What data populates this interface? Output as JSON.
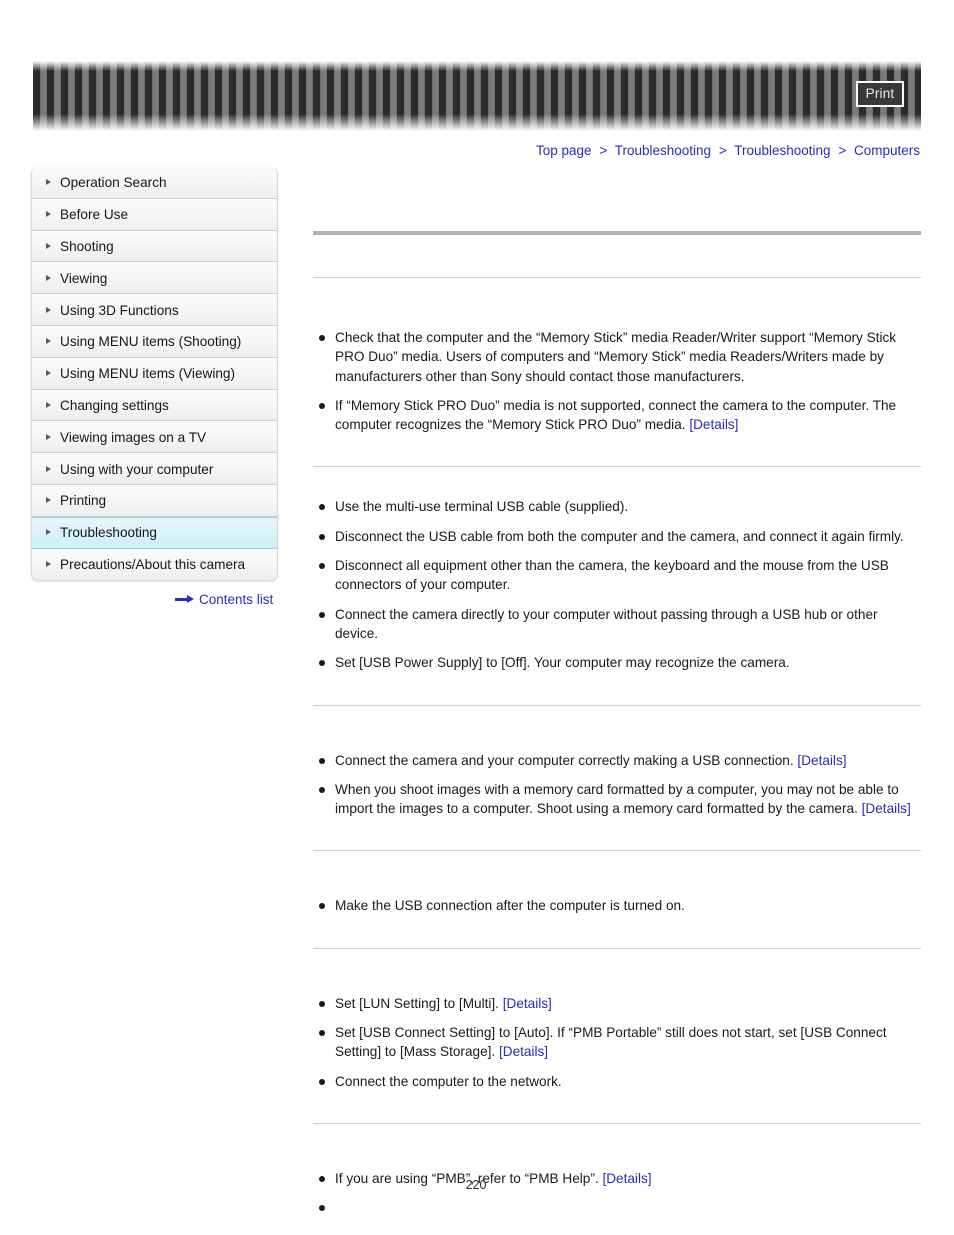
{
  "toolbar": {
    "print_label": "Print",
    "print_icon": "print-icon"
  },
  "breadcrumb": {
    "items": [
      {
        "label": "Top page"
      },
      {
        "label": "Troubleshooting"
      },
      {
        "label": "Troubleshooting"
      },
      {
        "label": "Computers"
      }
    ],
    "separator": ">"
  },
  "sidebar": {
    "items": [
      {
        "label": "Operation Search",
        "selected": false
      },
      {
        "label": "Before Use",
        "selected": false
      },
      {
        "label": "Shooting",
        "selected": false
      },
      {
        "label": "Viewing",
        "selected": false
      },
      {
        "label": "Using 3D Functions",
        "selected": false
      },
      {
        "label": "Using MENU items (Shooting)",
        "selected": false
      },
      {
        "label": "Using MENU items (Viewing)",
        "selected": false
      },
      {
        "label": "Changing settings",
        "selected": false
      },
      {
        "label": "Viewing images on a TV",
        "selected": false
      },
      {
        "label": "Using with your computer",
        "selected": false
      },
      {
        "label": "Printing",
        "selected": false
      },
      {
        "label": "Troubleshooting",
        "selected": true
      },
      {
        "label": "Precautions/About this camera",
        "selected": false
      }
    ],
    "contents_list_label": "Contents list",
    "contents_list_icon": "arrow-right-icon",
    "selected_accent": "#8fd6ea"
  },
  "main": {
    "page_title": "",
    "sections": [
      {
        "heading": "",
        "bullets": [
          {
            "text": "Check that the computer and the “Memory Stick” media Reader/Writer support “Memory Stick PRO Duo” media. Users of computers and “Memory Stick” media Readers/Writers made by manufacturers other than Sony should contact those manufacturers.",
            "link": ""
          },
          {
            "text": "If “Memory Stick PRO Duo” media is not supported, connect the camera to the computer. The computer recognizes the “Memory Stick PRO Duo” media.",
            "link": "[Details]"
          }
        ]
      },
      {
        "heading": "",
        "bullets": [
          {
            "text": "Use the multi-use terminal USB cable (supplied).",
            "link": ""
          },
          {
            "text": "Disconnect the USB cable from both the computer and the camera, and connect it again firmly.",
            "link": ""
          },
          {
            "text": "Disconnect all equipment other than the camera, the keyboard and the mouse from the USB connectors of your computer.",
            "link": ""
          },
          {
            "text": "Connect the camera directly to your computer without passing through a USB hub or other device.",
            "link": ""
          },
          {
            "text": "Set [USB Power Supply] to [Off]. Your computer may recognize the camera.",
            "link": ""
          }
        ]
      },
      {
        "heading": "",
        "bullets": [
          {
            "text": "Connect the camera and your computer correctly making a USB connection.",
            "link": "[Details]"
          },
          {
            "text": "When you shoot images with a memory card formatted by a computer, you may not be able to import the images to a computer. Shoot using a memory card formatted by the camera.",
            "link": "[Details]"
          }
        ]
      },
      {
        "heading": "",
        "bullets": [
          {
            "text": "Make the USB connection after the computer is turned on.",
            "link": ""
          }
        ]
      },
      {
        "heading": "",
        "bullets": [
          {
            "text": "Set [LUN Setting] to [Multi].",
            "link": "[Details]"
          },
          {
            "text": "Set [USB Connect Setting] to [Auto]. If “PMB Portable” still does not start, set [USB Connect Setting] to [Mass Storage].",
            "link": "[Details]"
          },
          {
            "text": "Connect the computer to the network.",
            "link": ""
          }
        ]
      },
      {
        "heading": "",
        "bullets": [
          {
            "text": "If you are using “PMB”, refer to “PMB Help”.",
            "link": "[Details]"
          },
          {
            "text": "",
            "link": ""
          }
        ]
      }
    ]
  },
  "footer": {
    "page_number": "220"
  },
  "colors": {
    "link": "#2b2bbb",
    "rule_thick": "#b4b4b4",
    "rule_thin": "#cfcfcf",
    "selected_bg": "#d9f2fa"
  }
}
